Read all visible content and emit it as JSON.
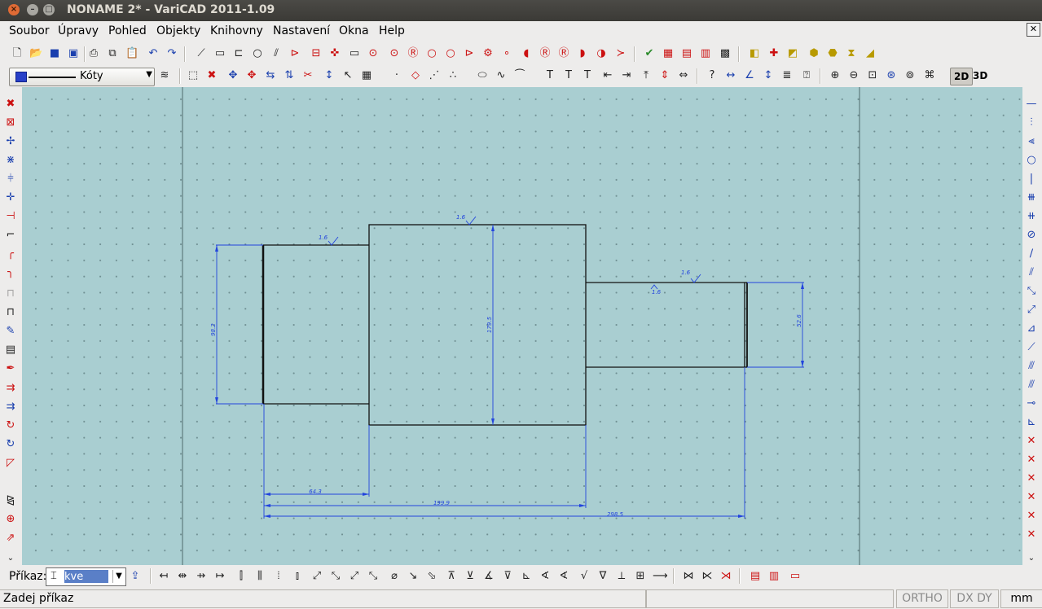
{
  "window": {
    "title": "NONAME 2* - VariCAD 2011-1.09"
  },
  "menu": [
    "Soubor",
    "Úpravy",
    "Pohled",
    "Objekty",
    "Knihovny",
    "Nastavení",
    "Okna",
    "Help"
  ],
  "toolbar2": {
    "layer_label": "Kóty",
    "mode_2d": "2D",
    "mode_3d": "3D"
  },
  "drawing": {
    "dimensions": [
      "98.2",
      "179.5",
      "52.6",
      "64.3",
      "199.9",
      "298.5"
    ],
    "surface_finish_labels": [
      "1.6",
      "1.6",
      "1.6",
      "1.6"
    ],
    "colors": {
      "geometry": "#000000",
      "dimension": "#2244dd",
      "background": "#a9ced1"
    }
  },
  "command": {
    "label": "Příkaz:",
    "value": "kve"
  },
  "status": {
    "message": "Zadej příkaz",
    "ortho": "ORTHO",
    "dxdy": "DX DY",
    "units": "mm"
  }
}
